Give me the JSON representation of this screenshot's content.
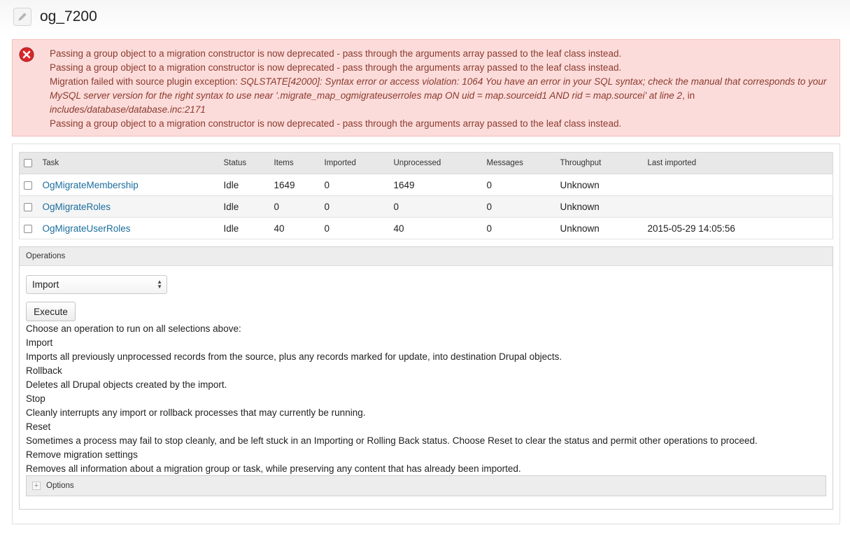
{
  "page": {
    "title": "og_7200"
  },
  "messages": [
    "Passing a group object to a migration constructor is now deprecated - pass through the arguments array passed to the leaf class instead.",
    "Passing a group object to a migration constructor is now deprecated - pass through the arguments array passed to the leaf class instead.",
    {
      "prefix": "Migration failed with source plugin exception: ",
      "detail": "SQLSTATE[42000]: Syntax error or access violation: 1064 You have an error in your SQL syntax; check the manual that corresponds to your MySQL server version for the right syntax to use near '.migrate_map_ogmigrateuserroles map ON uid = map.sourceid1 AND rid = map.sourcei' at line 2",
      "middle": ", in ",
      "location": "includes/database/database.inc:2171"
    },
    "Passing a group object to a migration constructor is now deprecated - pass through the arguments array passed to the leaf class instead."
  ],
  "table": {
    "columns": [
      "Task",
      "Status",
      "Items",
      "Imported",
      "Unprocessed",
      "Messages",
      "Throughput",
      "Last imported"
    ],
    "rows": [
      {
        "task": "OgMigrateMembership",
        "status": "Idle",
        "items": "1649",
        "imported": "0",
        "unprocessed": "1649",
        "messages": "0",
        "throughput": "Unknown",
        "last_imported": ""
      },
      {
        "task": "OgMigrateRoles",
        "status": "Idle",
        "items": "0",
        "imported": "0",
        "unprocessed": "0",
        "messages": "0",
        "throughput": "Unknown",
        "last_imported": ""
      },
      {
        "task": "OgMigrateUserRoles",
        "status": "Idle",
        "items": "40",
        "imported": "0",
        "unprocessed": "40",
        "messages": "0",
        "throughput": "Unknown",
        "last_imported": "2015-05-29 14:05:56"
      }
    ]
  },
  "operations": {
    "legend": "Operations",
    "select_value": "Import",
    "execute_label": "Execute",
    "help_intro": "Choose an operation to run on all selections above:",
    "help": [
      {
        "title": "Import",
        "description": "Imports all previously unprocessed records from the source, plus any records marked for update, into destination Drupal objects."
      },
      {
        "title": "Rollback",
        "description": "Deletes all Drupal objects created by the import."
      },
      {
        "title": "Stop",
        "description": "Cleanly interrupts any import or rollback processes that may currently be running."
      },
      {
        "title": "Reset",
        "description": "Sometimes a process may fail to stop cleanly, and be left stuck in an Importing or Rolling Back status. Choose Reset to clear the status and permit other operations to proceed."
      },
      {
        "title": "Remove migration settings",
        "description": "Removes all information about a migration group or task, while preserving any content that has already been imported."
      }
    ],
    "options_label": "Options"
  },
  "icons": {
    "edit": "pencil-icon",
    "error": "error-x-icon",
    "expand": "plus-icon"
  },
  "colors": {
    "error_bg": "#fcdcda",
    "error_text": "#8a3a2e",
    "error_icon": "#d9262b",
    "link": "#1a6d9e"
  }
}
